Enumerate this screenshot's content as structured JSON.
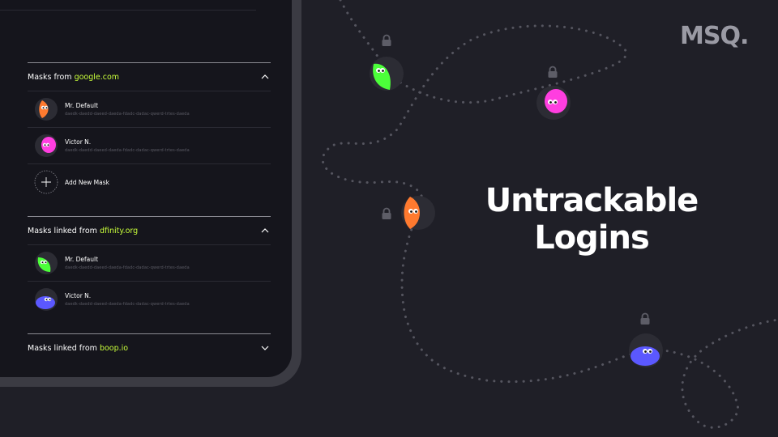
{
  "brand": {
    "logo_text": "MSQ."
  },
  "headline": {
    "line1": "Untrackable",
    "line2": "Logins"
  },
  "sections": [
    {
      "prefix": "Masks from ",
      "domain": "google.com",
      "expanded": true,
      "items": [
        {
          "name": "Mr. Default",
          "id": "daedk-daedd-daeed-daeda-fdadc-dadac-qwerd-trtes-daeda",
          "color": "#ff7a2f"
        },
        {
          "name": "Victor N.",
          "id": "daedk-daedd-daeed-daeda-fdadc-dadac-qwerd-trtes-daeda",
          "color": "#ff3ee0"
        }
      ],
      "add_label": "Add New Mask"
    },
    {
      "prefix": "Masks linked from ",
      "domain": "dfinity.org",
      "expanded": true,
      "items": [
        {
          "name": "Mr. Default",
          "id": "daedk-daedd-daeed-daeda-fdadc-dadac-qwerd-trtes-daeda",
          "color": "#4cff3a"
        },
        {
          "name": "Victor N.",
          "id": "daedk-daedd-daeed-daeda-fdadc-dadac-qwerd-trtes-daeda",
          "color": "#5b58ff"
        }
      ]
    },
    {
      "prefix": "Masks linked from ",
      "domain": "boop.io",
      "expanded": false,
      "items": []
    }
  ],
  "colors": {
    "background": "#1f1f27",
    "accent_domain": "#c9ff3a",
    "green": "#4cff3a",
    "pink": "#ff3ee0",
    "orange": "#ff7a2f",
    "blue": "#5b58ff"
  }
}
